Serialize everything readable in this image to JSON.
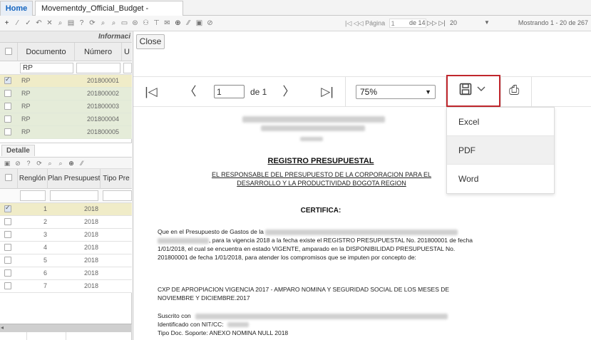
{
  "tabs": {
    "home": "Home",
    "doc": "Movementdy_Official_Budget -[qmovo]",
    "close": "×"
  },
  "toolbar": {
    "icons": [
      "+",
      "⁄",
      "✓",
      "↶",
      "✕",
      "⌕",
      "▤",
      "?",
      "⟳",
      "⌕",
      "⌕",
      "▭",
      "⊜",
      "⚇",
      "⊤",
      "✉",
      "⊕",
      "⁄⁄",
      "▣",
      "⊘"
    ],
    "pager_label": "|◁ ◁◁ Página",
    "page_value": "1",
    "of_label": "de 14 ▷▷ ▷|",
    "page_size": "20",
    "page_size_arrow": "▼",
    "showing": "Mostrando 1 - 20 de 267"
  },
  "grid": {
    "section_title": "Informaci",
    "col_documento": "Documento",
    "col_numero": "Número",
    "col_u": "U",
    "filter_documento": "RP",
    "rows": [
      {
        "doc": "RP",
        "num": "201800001",
        "selected": true
      },
      {
        "doc": "RP",
        "num": "201800002",
        "selected": false
      },
      {
        "doc": "RP",
        "num": "201800003",
        "selected": false
      },
      {
        "doc": "RP",
        "num": "201800004",
        "selected": false
      },
      {
        "doc": "RP",
        "num": "201800005",
        "selected": false
      }
    ]
  },
  "detalle": {
    "tab": "Detalle",
    "col_renglon": "Renglón",
    "col_plan": "Plan Presupuesto",
    "col_tipo": "Tipo Pre",
    "rows": [
      {
        "n": "1",
        "y": "2018",
        "selected": true
      },
      {
        "n": "2",
        "y": "2018",
        "selected": false
      },
      {
        "n": "3",
        "y": "2018",
        "selected": false
      },
      {
        "n": "4",
        "y": "2018",
        "selected": false
      },
      {
        "n": "5",
        "y": "2018",
        "selected": false
      },
      {
        "n": "6",
        "y": "2018",
        "selected": false
      },
      {
        "n": "7",
        "y": "2018",
        "selected": false
      }
    ]
  },
  "viewer": {
    "close": "Close",
    "page_value": "1",
    "of_label": "de 1",
    "zoom": "75%",
    "export_options": [
      "Excel",
      "PDF",
      "Word"
    ]
  },
  "report": {
    "title": "REGISTRO PRESUPUESTAL",
    "responsable": "EL RESPONSABLE DEL PRESUPUESTO DE LA  CORPORACION PARA EL DESARROLLO Y LA PRODUCTIVIDAD BOGOTA REGION",
    "certifica": "CERTIFICA:",
    "p1_a": "Que en el Presupuesto de Gastos de la",
    "p1_b": ", para la vigencia 2018 a la fecha existe el REGISTRO PRESUPUESTAL No. 201800001 de fecha  1/01/2018, el cual se encuentra en estado VIGENTE, amparado en la DISPONIBILIDAD PRESUPUESTAL No. 201800001 de fecha 1/01/2018, para atender los compromisos que se imputen por concepto de:",
    "p2": "CXP DE APROPIACION VIGENCIA 2017 - AMPARO NOMINA Y SEGURIDAD SOCIAL DE LOS MESES DE NOVIEMBRE Y DICIEMBRE.2017",
    "suscrito": "Suscrito con",
    "identificado": "Identificado con NIT/CC:",
    "tipo_doc": "Tipo Doc. Soporte: ANEXO NOMINA NULL 2018"
  }
}
